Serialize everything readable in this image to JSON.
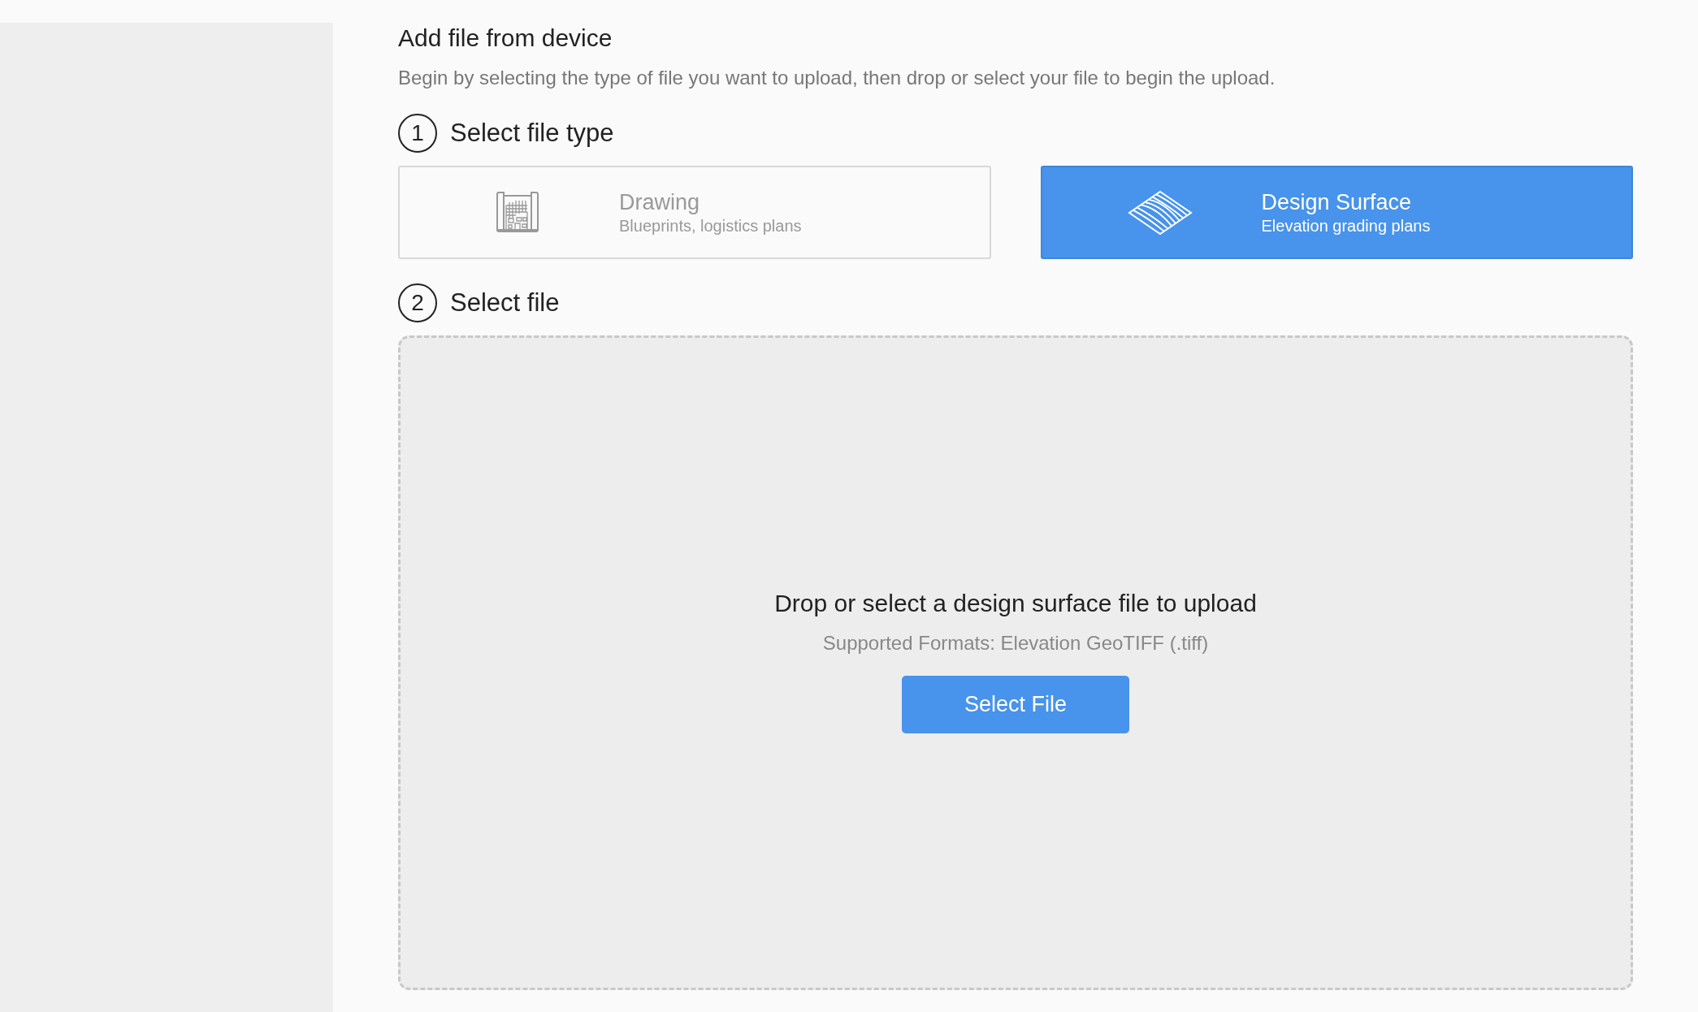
{
  "title": "Add file from device",
  "description": "Begin by selecting the type of file you want to upload, then drop or select your file to begin the upload.",
  "steps": [
    {
      "number": "1",
      "label": "Select file type"
    },
    {
      "number": "2",
      "label": "Select file"
    }
  ],
  "file_types": [
    {
      "kind": "drawing",
      "name": "Drawing",
      "subtitle": "Blueprints, logistics plans",
      "selected": false
    },
    {
      "kind": "surface",
      "name": "Design Surface",
      "subtitle": "Elevation grading plans",
      "selected": true
    }
  ],
  "dropzone": {
    "heading": "Drop or select a design surface file to upload",
    "formats": "Supported Formats: Elevation GeoTIFF (.tiff)",
    "button": "Select File"
  }
}
